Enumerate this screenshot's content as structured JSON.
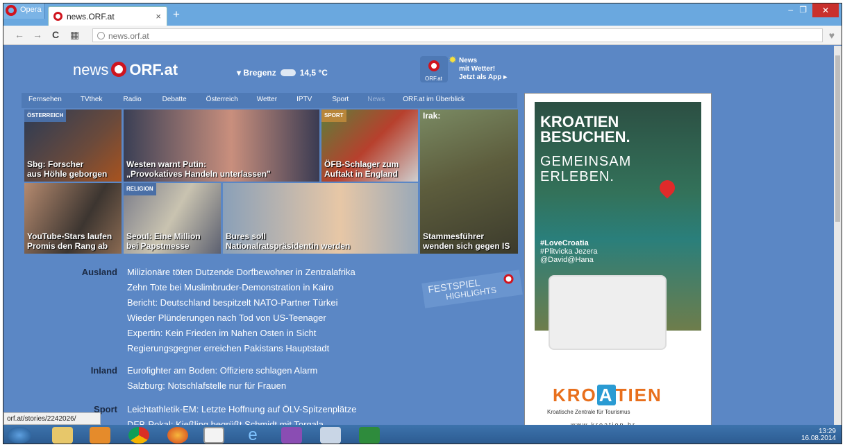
{
  "browser": {
    "opera_label": "Opera",
    "tab_title": "news.ORF.at",
    "tab_close": "×",
    "new_tab": "+",
    "url": "news.orf.at"
  },
  "header": {
    "logo_news": "news",
    "logo_orf": "ORF.at",
    "weather_location": "▾ Bregenz",
    "weather_temp": "14,5 °C",
    "app_label": "ORF.at",
    "app_line1": "News",
    "app_line2": "mit Wetter!",
    "app_line3": "Jetzt als App ▸"
  },
  "nav": [
    "Fernsehen",
    "TVthek",
    "Radio",
    "Debatte",
    "Österreich",
    "Wetter",
    "IPTV",
    "Sport",
    "News",
    "ORF.at im Überblick"
  ],
  "tiles": {
    "t1": {
      "label": "ÖSTERREICH",
      "caption_1": "Sbg: Forscher",
      "caption_2": "aus Höhle geborgen"
    },
    "t2": {
      "caption_1": "Westen warnt Putin:",
      "caption_2": "„Provokatives Handeln unterlassen\""
    },
    "t3": {
      "label": "SPORT",
      "caption_1": "ÖFB-Schlager zum",
      "caption_2": "Auftakt in England"
    },
    "t4": {
      "label": "Irak:",
      "caption_1": "Stammesführer",
      "caption_2": "wenden sich gegen IS"
    },
    "t5": {
      "caption_1": "YouTube-Stars laufen",
      "caption_2": "Promis den Rang ab"
    },
    "t6": {
      "label": "RELIGION",
      "caption_1": "Seoul: Eine Million",
      "caption_2": "bei Papstmesse"
    },
    "t7": {
      "caption_1": "Bures soll",
      "caption_2": "Nationalratspräsidentin werden"
    }
  },
  "news": {
    "ausland_label": "Ausland",
    "ausland": [
      "Milizionäre töten Dutzende Dorfbewohner in Zentralafrika",
      "Zehn Tote bei Muslimbruder-Demonstration in Kairo",
      "Bericht: Deutschland bespitzelt NATO-Partner Türkei",
      "Wieder Plünderungen nach Tod von US-Teenager",
      "Expertin: Kein Frieden im Nahen Osten in Sicht",
      "Regierungsgegner erreichen Pakistans Hauptstadt"
    ],
    "inland_label": "Inland",
    "inland": [
      "Eurofighter am Boden: Offiziere schlagen Alarm",
      "Salzburg: Notschlafstelle nur für Frauen"
    ],
    "sport_label": "Sport",
    "sport": [
      "Leichtathletik-EM: Letzte Hoffnung auf ÖLV-Spitzenplätze",
      "DFB-Pokal: Kießling begrüßt Schmidt mit Torgala"
    ]
  },
  "festspiel": {
    "line1": "FESTSPIEL",
    "line2": "HIGHLIGHTS"
  },
  "ad": {
    "head1": "KROATIEN",
    "head2": "BESUCHEN.",
    "sub1": "GEMEINSAM",
    "sub2": "ERLEBEN.",
    "tag1": "#LoveCroatia",
    "tag2": "#Plitvicka Jezera",
    "tag3": "@David@Hana",
    "logo_pre": "KRO",
    "logo_a": "A",
    "logo_post": "TIEN",
    "small": "Kroatische Zentrale für Tourismus",
    "url": "www.kroatien.hr"
  },
  "status_url": "orf.at/stories/2242026/",
  "tray": {
    "time": "13:29",
    "date": "16.08.2014"
  }
}
